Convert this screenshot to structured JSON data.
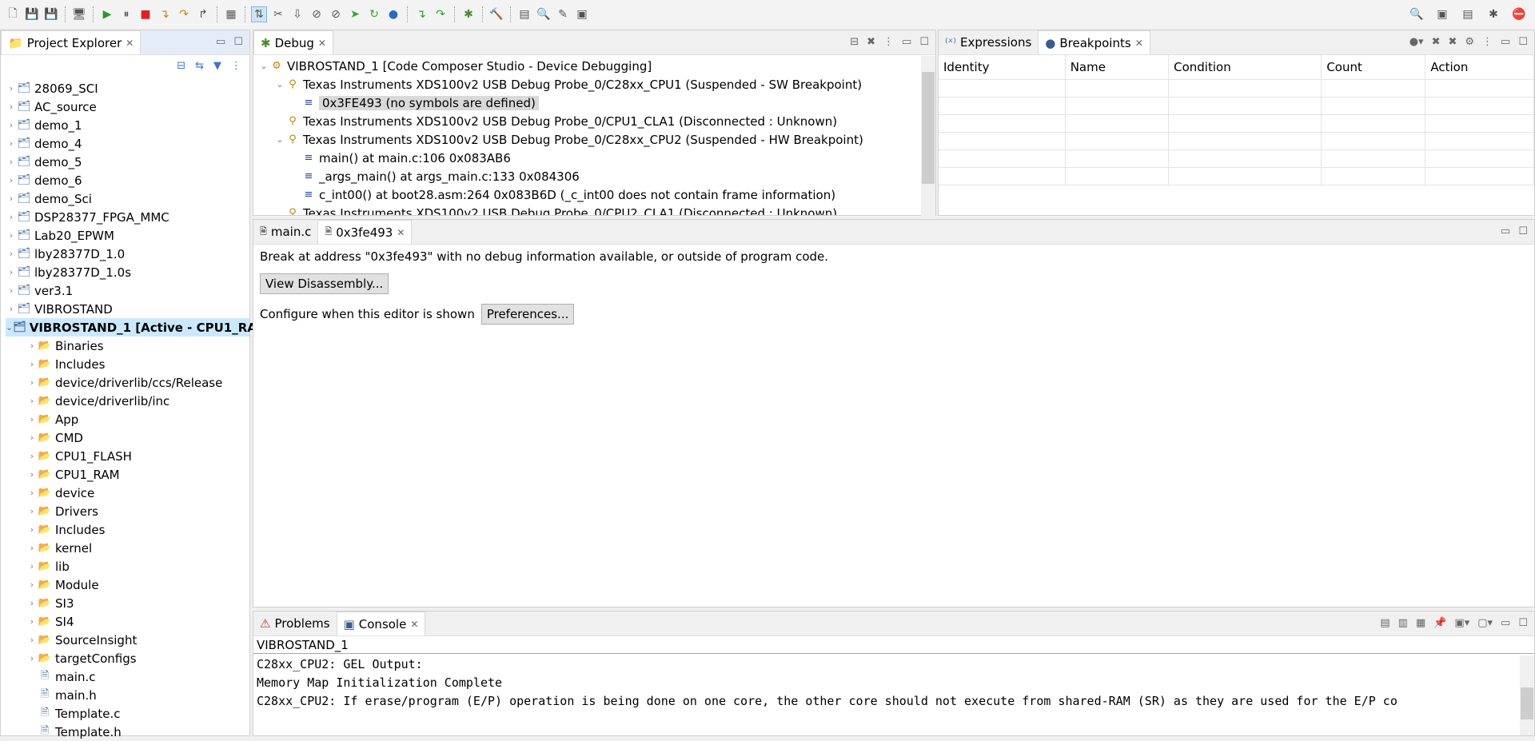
{
  "toolbar": {
    "icons": [
      "new-icon",
      "save-icon",
      "save-all-icon",
      "terminal-icon",
      "resume-icon",
      "suspend-icon",
      "terminate-icon",
      "step-into-icon",
      "step-over-icon",
      "step-return-icon",
      "memory-grid-icon",
      "connect-target-icon",
      "disconnect-icon",
      "load-program-icon",
      "breakpoint-icon",
      "skip-breakpoints-icon",
      "run-icon",
      "restart-icon",
      "reset-icon",
      "assembly-step-into-icon",
      "assembly-step-over-icon",
      "debug-icon",
      "build-icon",
      "open-element-icon",
      "search-icon",
      "pin-icon",
      "open-perspective-icon"
    ],
    "right_icons": [
      "search-icon",
      "open-perspective-icon",
      "ccs-edit-icon",
      "debug-perspective-icon",
      "stop-icon"
    ]
  },
  "project_explorer": {
    "title": "Project Explorer",
    "items": [
      {
        "label": "28069_SCI",
        "level": 0
      },
      {
        "label": "AC_source",
        "level": 0
      },
      {
        "label": "demo_1",
        "level": 0
      },
      {
        "label": "demo_4",
        "level": 0
      },
      {
        "label": "demo_5",
        "level": 0
      },
      {
        "label": "demo_6",
        "level": 0
      },
      {
        "label": "demo_Sci",
        "level": 0
      },
      {
        "label": "DSP28377_FPGA_MMC",
        "level": 0
      },
      {
        "label": "Lab20_EPWM",
        "level": 0
      },
      {
        "label": "lby28377D_1.0",
        "level": 0
      },
      {
        "label": "lby28377D_1.0s",
        "level": 0
      },
      {
        "label": "ver3.1",
        "level": 0
      },
      {
        "label": "VIBROSTAND",
        "level": 0
      },
      {
        "label": "VIBROSTAND_1  [Active - CPU1_RA",
        "level": 0,
        "expanded": true,
        "selected": true
      },
      {
        "label": "Binaries",
        "level": 1
      },
      {
        "label": "Includes",
        "level": 1
      },
      {
        "label": "device/driverlib/ccs/Release",
        "level": 1
      },
      {
        "label": "device/driverlib/inc",
        "level": 1
      },
      {
        "label": "App",
        "level": 1
      },
      {
        "label": "CMD",
        "level": 1
      },
      {
        "label": "CPU1_FLASH",
        "level": 1
      },
      {
        "label": "CPU1_RAM",
        "level": 1
      },
      {
        "label": "device",
        "level": 1
      },
      {
        "label": "Drivers",
        "level": 1
      },
      {
        "label": "Includes",
        "level": 1
      },
      {
        "label": "kernel",
        "level": 1
      },
      {
        "label": "lib",
        "level": 1
      },
      {
        "label": "Module",
        "level": 1
      },
      {
        "label": "SI3",
        "level": 1
      },
      {
        "label": "SI4",
        "level": 1
      },
      {
        "label": "SourceInsight",
        "level": 1
      },
      {
        "label": "targetConfigs",
        "level": 1
      },
      {
        "label": "main.c",
        "level": 1,
        "file": true
      },
      {
        "label": "main.h",
        "level": 1,
        "file": true
      },
      {
        "label": "Template.c",
        "level": 1,
        "file": true
      },
      {
        "label": "Template.h",
        "level": 1,
        "file": true
      }
    ]
  },
  "debug": {
    "title": "Debug",
    "items": [
      {
        "label": "VIBROSTAND_1 [Code Composer Studio - Device Debugging]",
        "level": 0
      },
      {
        "label": "Texas Instruments XDS100v2 USB Debug Probe_0/C28xx_CPU1 (Suspended - SW Breakpoint)",
        "level": 1
      },
      {
        "label": "0x3FE493  (no symbols are defined)",
        "level": 2,
        "selected": true
      },
      {
        "label": "Texas Instruments XDS100v2 USB Debug Probe_0/CPU1_CLA1 (Disconnected : Unknown)",
        "level": 1
      },
      {
        "label": "Texas Instruments XDS100v2 USB Debug Probe_0/C28xx_CPU2 (Suspended - HW Breakpoint)",
        "level": 1
      },
      {
        "label": "main() at main.c:106 0x083AB6",
        "level": 2
      },
      {
        "label": "_args_main() at args_main.c:133 0x084306",
        "level": 2
      },
      {
        "label": "c_int00() at boot28.asm:264 0x083B6D  (_c_int00 does not contain frame information)",
        "level": 2
      },
      {
        "label": "Texas Instruments XDS100v2 USB Debug Probe_0/CPU2_CLA1 (Disconnected : Unknown)",
        "level": 1
      }
    ]
  },
  "breakpoints": {
    "tabs": [
      "Expressions",
      "Breakpoints"
    ],
    "columns": [
      "Identity",
      "Name",
      "Condition",
      "Count",
      "Action"
    ]
  },
  "editor": {
    "tabs": [
      "main.c",
      "0x3fe493"
    ],
    "message": "Break at address \"0x3fe493\" with no debug information available, or outside of program code.",
    "view_disassembly": "View Disassembly...",
    "configure_label": "Configure when this editor is shown",
    "preferences": "Preferences..."
  },
  "console": {
    "tabs": [
      "Problems",
      "Console"
    ],
    "name": "VIBROSTAND_1",
    "lines": [
      "C28xx_CPU2: GEL Output:",
      "Memory Map Initialization Complete",
      "C28xx_CPU2: If erase/program (E/P) operation is being done on one core, the other core should not execute from shared-RAM (SR) as they are used for the E/P co"
    ]
  }
}
